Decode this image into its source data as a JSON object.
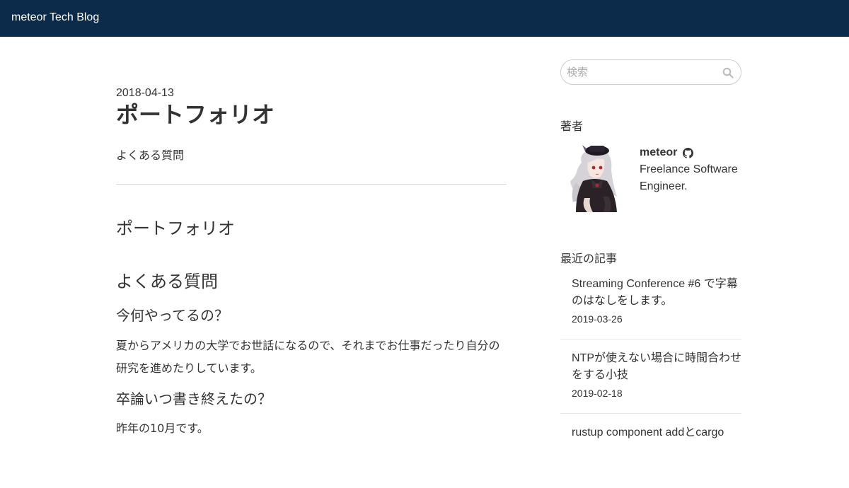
{
  "navbar": {
    "brand": "meteor Tech Blog"
  },
  "post": {
    "date": "2018-04-13",
    "title": "ポートフォリオ",
    "description": "よくある質問",
    "sections": {
      "portfolio_heading": "ポートフォリオ",
      "faq_heading": "よくある質問",
      "questions": [
        {
          "question": "今何やってるの？",
          "answer": "夏からアメリカの大学でお世話になるので、それまでお仕事だったり自分の研究を進めたりしています。"
        },
        {
          "question": "卒論いつ書き終えたの？",
          "answer": "昨年の10月です。"
        }
      ]
    }
  },
  "sidebar": {
    "search": {
      "placeholder": "検索",
      "value": ""
    },
    "author": {
      "heading": "著者",
      "name": "meteor",
      "bio": "Freelance Software Engineer."
    },
    "recent": {
      "heading": "最近の記事",
      "items": [
        {
          "title": "Streaming Conference #6 で字幕のはなしをします。",
          "date": "2019-03-26"
        },
        {
          "title": "NTPが使えない場合に時間合わせをする小技",
          "date": "2019-02-18"
        },
        {
          "title": "rustup component addとcargo",
          "date": ""
        }
      ]
    }
  },
  "icons": {
    "search": "search-icon",
    "github": "github-icon"
  },
  "colors": {
    "navbar_bg": "#0c2a4a",
    "navbar_text": "#ffffff",
    "body_text": "#333333",
    "divider": "#d9d9d9"
  }
}
